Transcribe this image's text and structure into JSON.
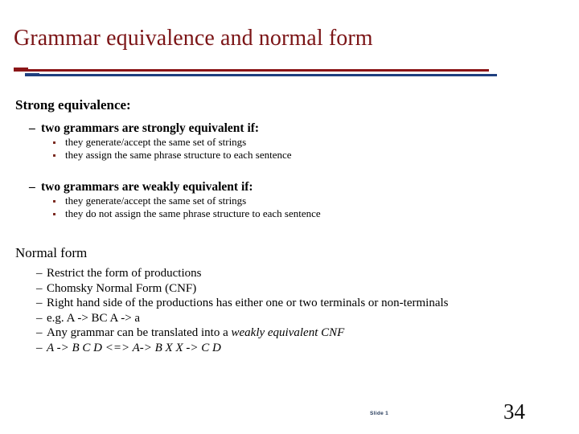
{
  "slide": {
    "title": "Grammar equivalence and normal form",
    "colors": {
      "title": "#7B1416",
      "rule_red": "#8B1517",
      "rule_blue": "#1F3F7F",
      "bullet_square": "#7B2B22",
      "slide_marker": "#253A5A",
      "page_number": "#111111",
      "background": "#FFFFFF"
    },
    "sections": {
      "strong": {
        "heading": "Strong equivalence:",
        "groups": [
          {
            "dash": "–",
            "label": "two grammars are strongly equivalent if:",
            "bullets": [
              "they generate/accept the same set of strings",
              "they assign the same phrase structure to each sentence"
            ]
          },
          {
            "dash": "–",
            "label": "two grammars are weakly equivalent if:",
            "bullets": [
              "they generate/accept the same set of strings",
              "they do not assign the same phrase structure to each sentence"
            ]
          }
        ]
      },
      "normal_form": {
        "heading": "Normal form",
        "dash": "–",
        "items": [
          {
            "text": "Restrict the form of productions",
            "italic_tail": "",
            "all_italic": false
          },
          {
            "text": "Chomsky Normal Form (CNF)",
            "italic_tail": "",
            "all_italic": false
          },
          {
            "text": "Right hand side of the productions has either one or two terminals or non-terminals",
            "italic_tail": "",
            "all_italic": false
          },
          {
            "text": "e.g. A -> BC   A -> a",
            "italic_tail": "",
            "all_italic": false
          },
          {
            "text": "Any grammar can be translated into a ",
            "italic_tail": "weakly equivalent CNF",
            "all_italic": false
          },
          {
            "text": "A -> B C D  <=>  A-> B X    X -> C D",
            "italic_tail": "",
            "all_italic": true
          }
        ]
      }
    },
    "footer": {
      "slide_marker": "Slide 1",
      "page_number": "34"
    }
  }
}
